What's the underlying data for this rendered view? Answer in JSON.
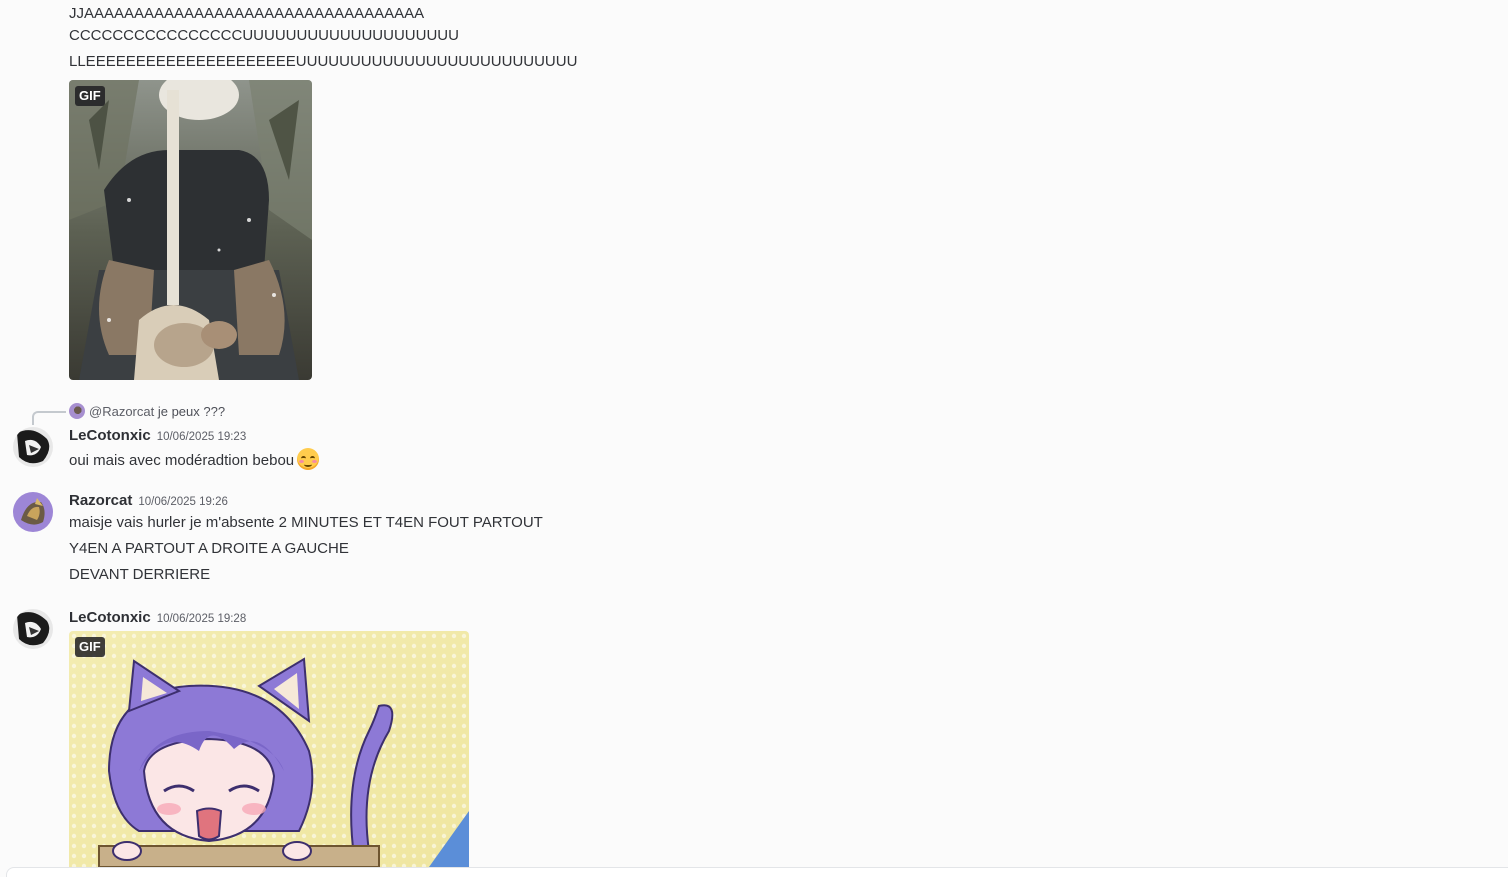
{
  "messages": {
    "continuation": {
      "lines": [
        "JJAAAAAAAAAAAAAAAAAAAAAAAAAAAAAAAAAA",
        "CCCCCCCCCCCCCCCCUUUUUUUUUUUUUUUUUUUU",
        "LLEEEEEEEEEEEEEEEEEEEEEUUUUUUUUUUUUUUUUUUUUUUUUUU"
      ],
      "gif_badge": "GIF"
    },
    "msg1": {
      "reply_mention": "@Razorcat",
      "reply_text": "je peux ???",
      "username": "LeCotonxic",
      "timestamp": "10/06/2025 19:23",
      "text": "oui mais avec modéradtion bebou",
      "emoji": "smiling-face-with-blush-emoji"
    },
    "msg2": {
      "username": "Razorcat",
      "timestamp": "10/06/2025 19:26",
      "lines": [
        "maisje vais hurler je m'absente 2 MINUTES ET T4EN FOUT PARTOUT",
        "Y4EN A PARTOUT A DROITE A GAUCHE",
        "DEVANT DERRIERE"
      ]
    },
    "msg3": {
      "username": "LeCotonxic",
      "timestamp": "10/06/2025 19:28",
      "gif_badge": "GIF"
    }
  },
  "colors": {
    "background": "#fbfbfb",
    "text": "#313338",
    "muted": "#5c5e66"
  }
}
